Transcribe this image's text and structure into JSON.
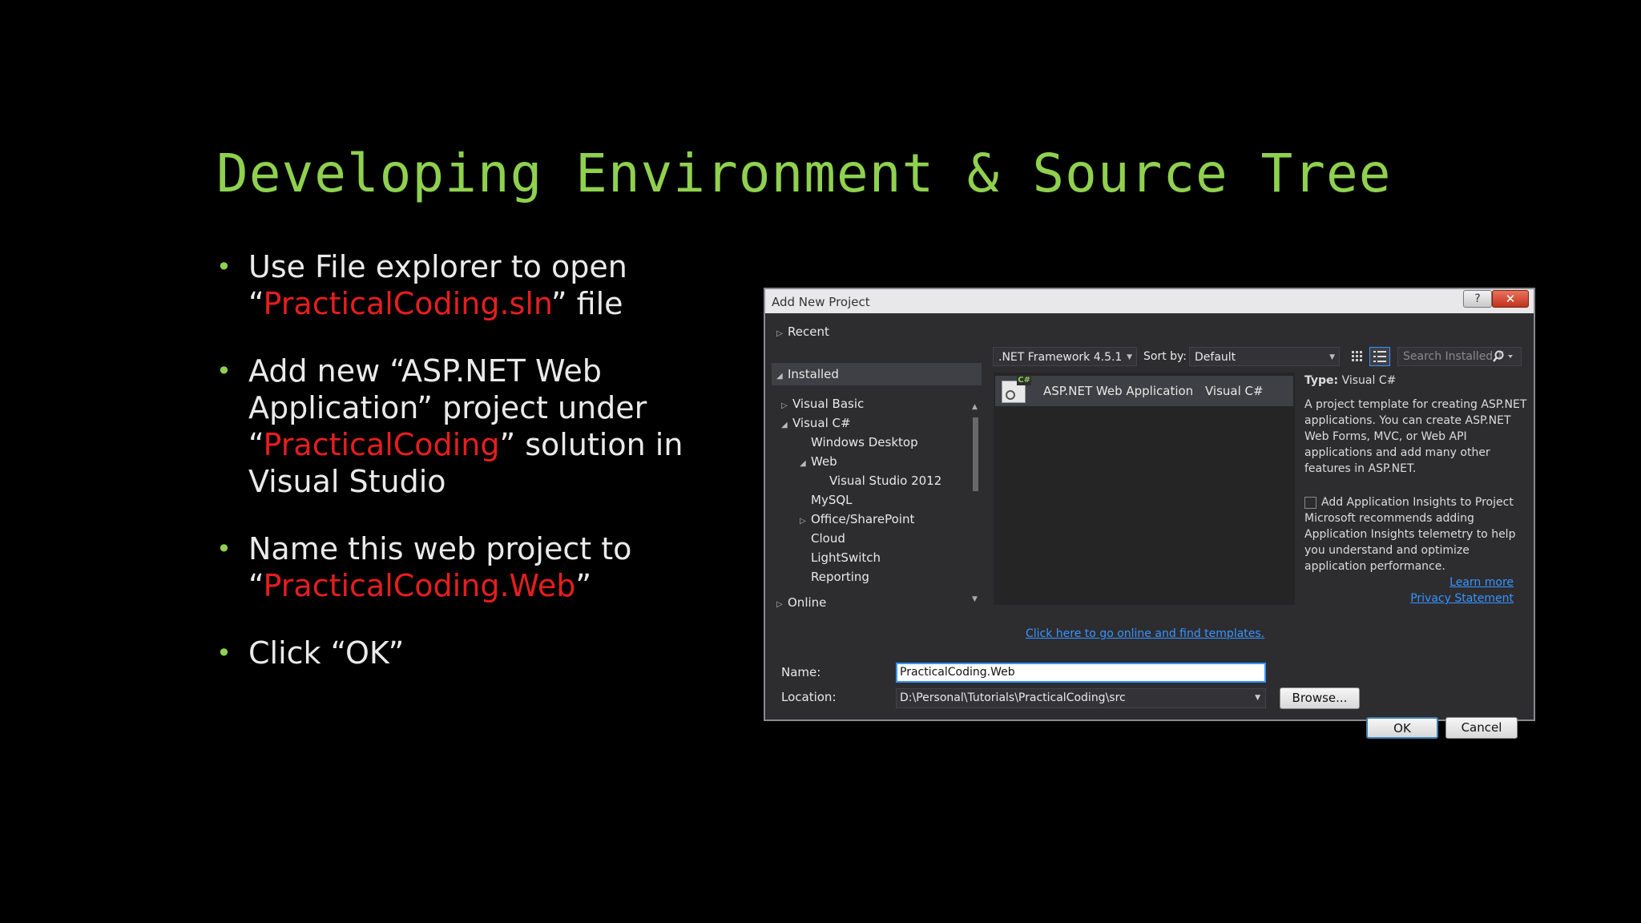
{
  "slide": {
    "title": "Developing Environment & Source Tree",
    "bullet_glyph": "•",
    "bullets": [
      {
        "pre": "Use File explorer to open “",
        "red": "PracticalCoding.sln",
        "post": "” file"
      },
      {
        "pre": "Add new “ASP.NET Web Application” project under “",
        "red": "PracticalCoding",
        "post": "” solution in Visual Studio"
      },
      {
        "pre": "Name this web project to “",
        "red": "PracticalCoding.Web",
        "post": "”"
      },
      {
        "pre": "Click “OK”",
        "red": "",
        "post": ""
      }
    ]
  },
  "dialog": {
    "title": "Add New Project",
    "help_label": "?",
    "close_label": "✕",
    "tree": {
      "recent": "Recent",
      "installed": "Installed",
      "visual_basic": "Visual Basic",
      "visual_csharp": "Visual C#",
      "windows_desktop": "Windows Desktop",
      "web": "Web",
      "vs2012": "Visual Studio 2012",
      "mysql": "MySQL",
      "office": "Office/SharePoint",
      "cloud": "Cloud",
      "lightswitch": "LightSwitch",
      "reporting": "Reporting",
      "online": "Online"
    },
    "toolbar": {
      "framework": ".NET Framework 4.5.1",
      "sort_label": "Sort by:",
      "sort_value": "Default",
      "search_placeholder": "Search Installed T"
    },
    "template": {
      "name": "ASP.NET Web Application",
      "lang": "Visual C#",
      "icon_badge": "C#"
    },
    "details": {
      "type_label": "Type:",
      "type_value": "Visual C#",
      "description": "A project template for creating ASP.NET applications. You can create ASP.NET Web Forms, MVC,  or Web API applications and add many other features in ASP.NET.",
      "insights_label": "Add Application Insights to Project",
      "insights_text": "Microsoft recommends adding Application Insights telemetry to help you understand and optimize application performance.",
      "learn_more": "Learn more",
      "privacy": "Privacy Statement"
    },
    "online_link": "Click here to go online and find templates.",
    "name_label": "Name:",
    "name_value": "PracticalCoding.Web",
    "location_label": "Location:",
    "location_value": "D:\\Personal\\Tutorials\\PracticalCoding\\src",
    "browse_label": "Browse...",
    "ok_label": "OK",
    "cancel_label": "Cancel"
  }
}
